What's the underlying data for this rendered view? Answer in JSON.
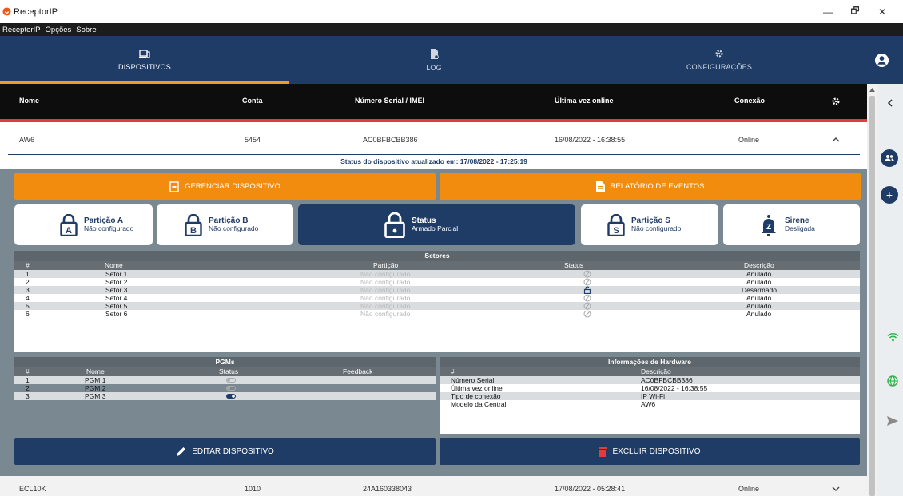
{
  "window": {
    "title": "ReceptorIP",
    "min_label": "—",
    "max_label": "🗗",
    "close_label": "✕"
  },
  "menu": [
    "ReceptorIP",
    "Opções",
    "Sobre"
  ],
  "nav": {
    "tabs": [
      {
        "label": "DISPOSITIVOS",
        "icon": "devices-icon",
        "active": true
      },
      {
        "label": "LOG",
        "icon": "file-log-icon",
        "active": false
      },
      {
        "label": "CONFIGURAÇÕES",
        "icon": "gear-icon",
        "active": false
      }
    ]
  },
  "device_table": {
    "headers": {
      "name": "Nome",
      "account": "Conta",
      "serial": "Número Serial / IMEI",
      "last_online": "Última vez online",
      "connection": "Conexão"
    }
  },
  "devices": [
    {
      "name": "AW6",
      "account": "5454",
      "serial": "AC0BFBCBB386",
      "last_online": "16/08/2022 - 16:38:55",
      "connection": "Online",
      "expanded": true
    },
    {
      "name": "ECL10K",
      "account": "1010",
      "serial": "24A160338043",
      "last_online": "17/08/2022 - 05:28:41",
      "connection": "Online",
      "expanded": false
    }
  ],
  "detail": {
    "status_updated": "Status do dispositivo atualizado em: 17/08/2022 - 17:25:19",
    "manage_label": "GERENCIAR DISPOSITIVO",
    "report_label": "RELATÓRIO DE EVENTOS",
    "edit_label": "EDITAR DISPOSITIVO",
    "delete_label": "EXCLUIR DISPOSITIVO",
    "partitions": [
      {
        "title": "Partição A",
        "sub": "Não configurado",
        "letter": "A"
      },
      {
        "title": "Partição B",
        "sub": "Não configurado",
        "letter": "B"
      },
      {
        "title": "Status",
        "sub": "Armado Parcial",
        "letter": ""
      },
      {
        "title": "Partição S",
        "sub": "Não configurado",
        "letter": "S"
      },
      {
        "title": "Sirene",
        "sub": "Desligada",
        "letter": "Z"
      }
    ],
    "sectors": {
      "caption": "Setores",
      "headers": [
        "#",
        "Nome",
        "Partição",
        "Status",
        "Descrição"
      ],
      "rows": [
        [
          "1",
          "Setor 1",
          "Não configurado",
          "blocked",
          "Anulado"
        ],
        [
          "2",
          "Setor 2",
          "Não configurado",
          "blocked",
          "Anulado"
        ],
        [
          "3",
          "Setor 3",
          "Não configurado",
          "unlocked",
          "Desarmado"
        ],
        [
          "4",
          "Setor 4",
          "Não configurado",
          "blocked",
          "Anulado"
        ],
        [
          "5",
          "Setor 5",
          "Não configurado",
          "blocked",
          "Anulado"
        ],
        [
          "6",
          "Setor 6",
          "Não configurado",
          "blocked",
          "Anulado"
        ]
      ]
    },
    "pgms": {
      "caption": "PGMs",
      "headers": [
        "#",
        "Nome",
        "Status",
        "Feedback"
      ],
      "rows": [
        [
          "1",
          "PGM 1",
          "off",
          ""
        ],
        [
          "2",
          "PGM 2",
          "off",
          ""
        ],
        [
          "3",
          "PGM 3",
          "on",
          ""
        ]
      ]
    },
    "hardware": {
      "caption": "Informações de Hardware",
      "headers": [
        "#",
        "Descrição"
      ],
      "rows": [
        [
          "Número Serial",
          "AC0BFBCBB386"
        ],
        [
          "Última vez online",
          "16/08/2022 - 16:38:55"
        ],
        [
          "Tipo de conexão",
          "IP Wi-Fi"
        ],
        [
          "Modelo da Central",
          "AW6"
        ]
      ]
    }
  },
  "side_actions": [
    "group-icon",
    "add-icon"
  ],
  "side_status": [
    "wifi-icon",
    "globe-icon",
    "send-icon"
  ],
  "colors": {
    "navy": "#1f3c66",
    "orange": "#f28c0f",
    "red": "#e23b3b"
  }
}
